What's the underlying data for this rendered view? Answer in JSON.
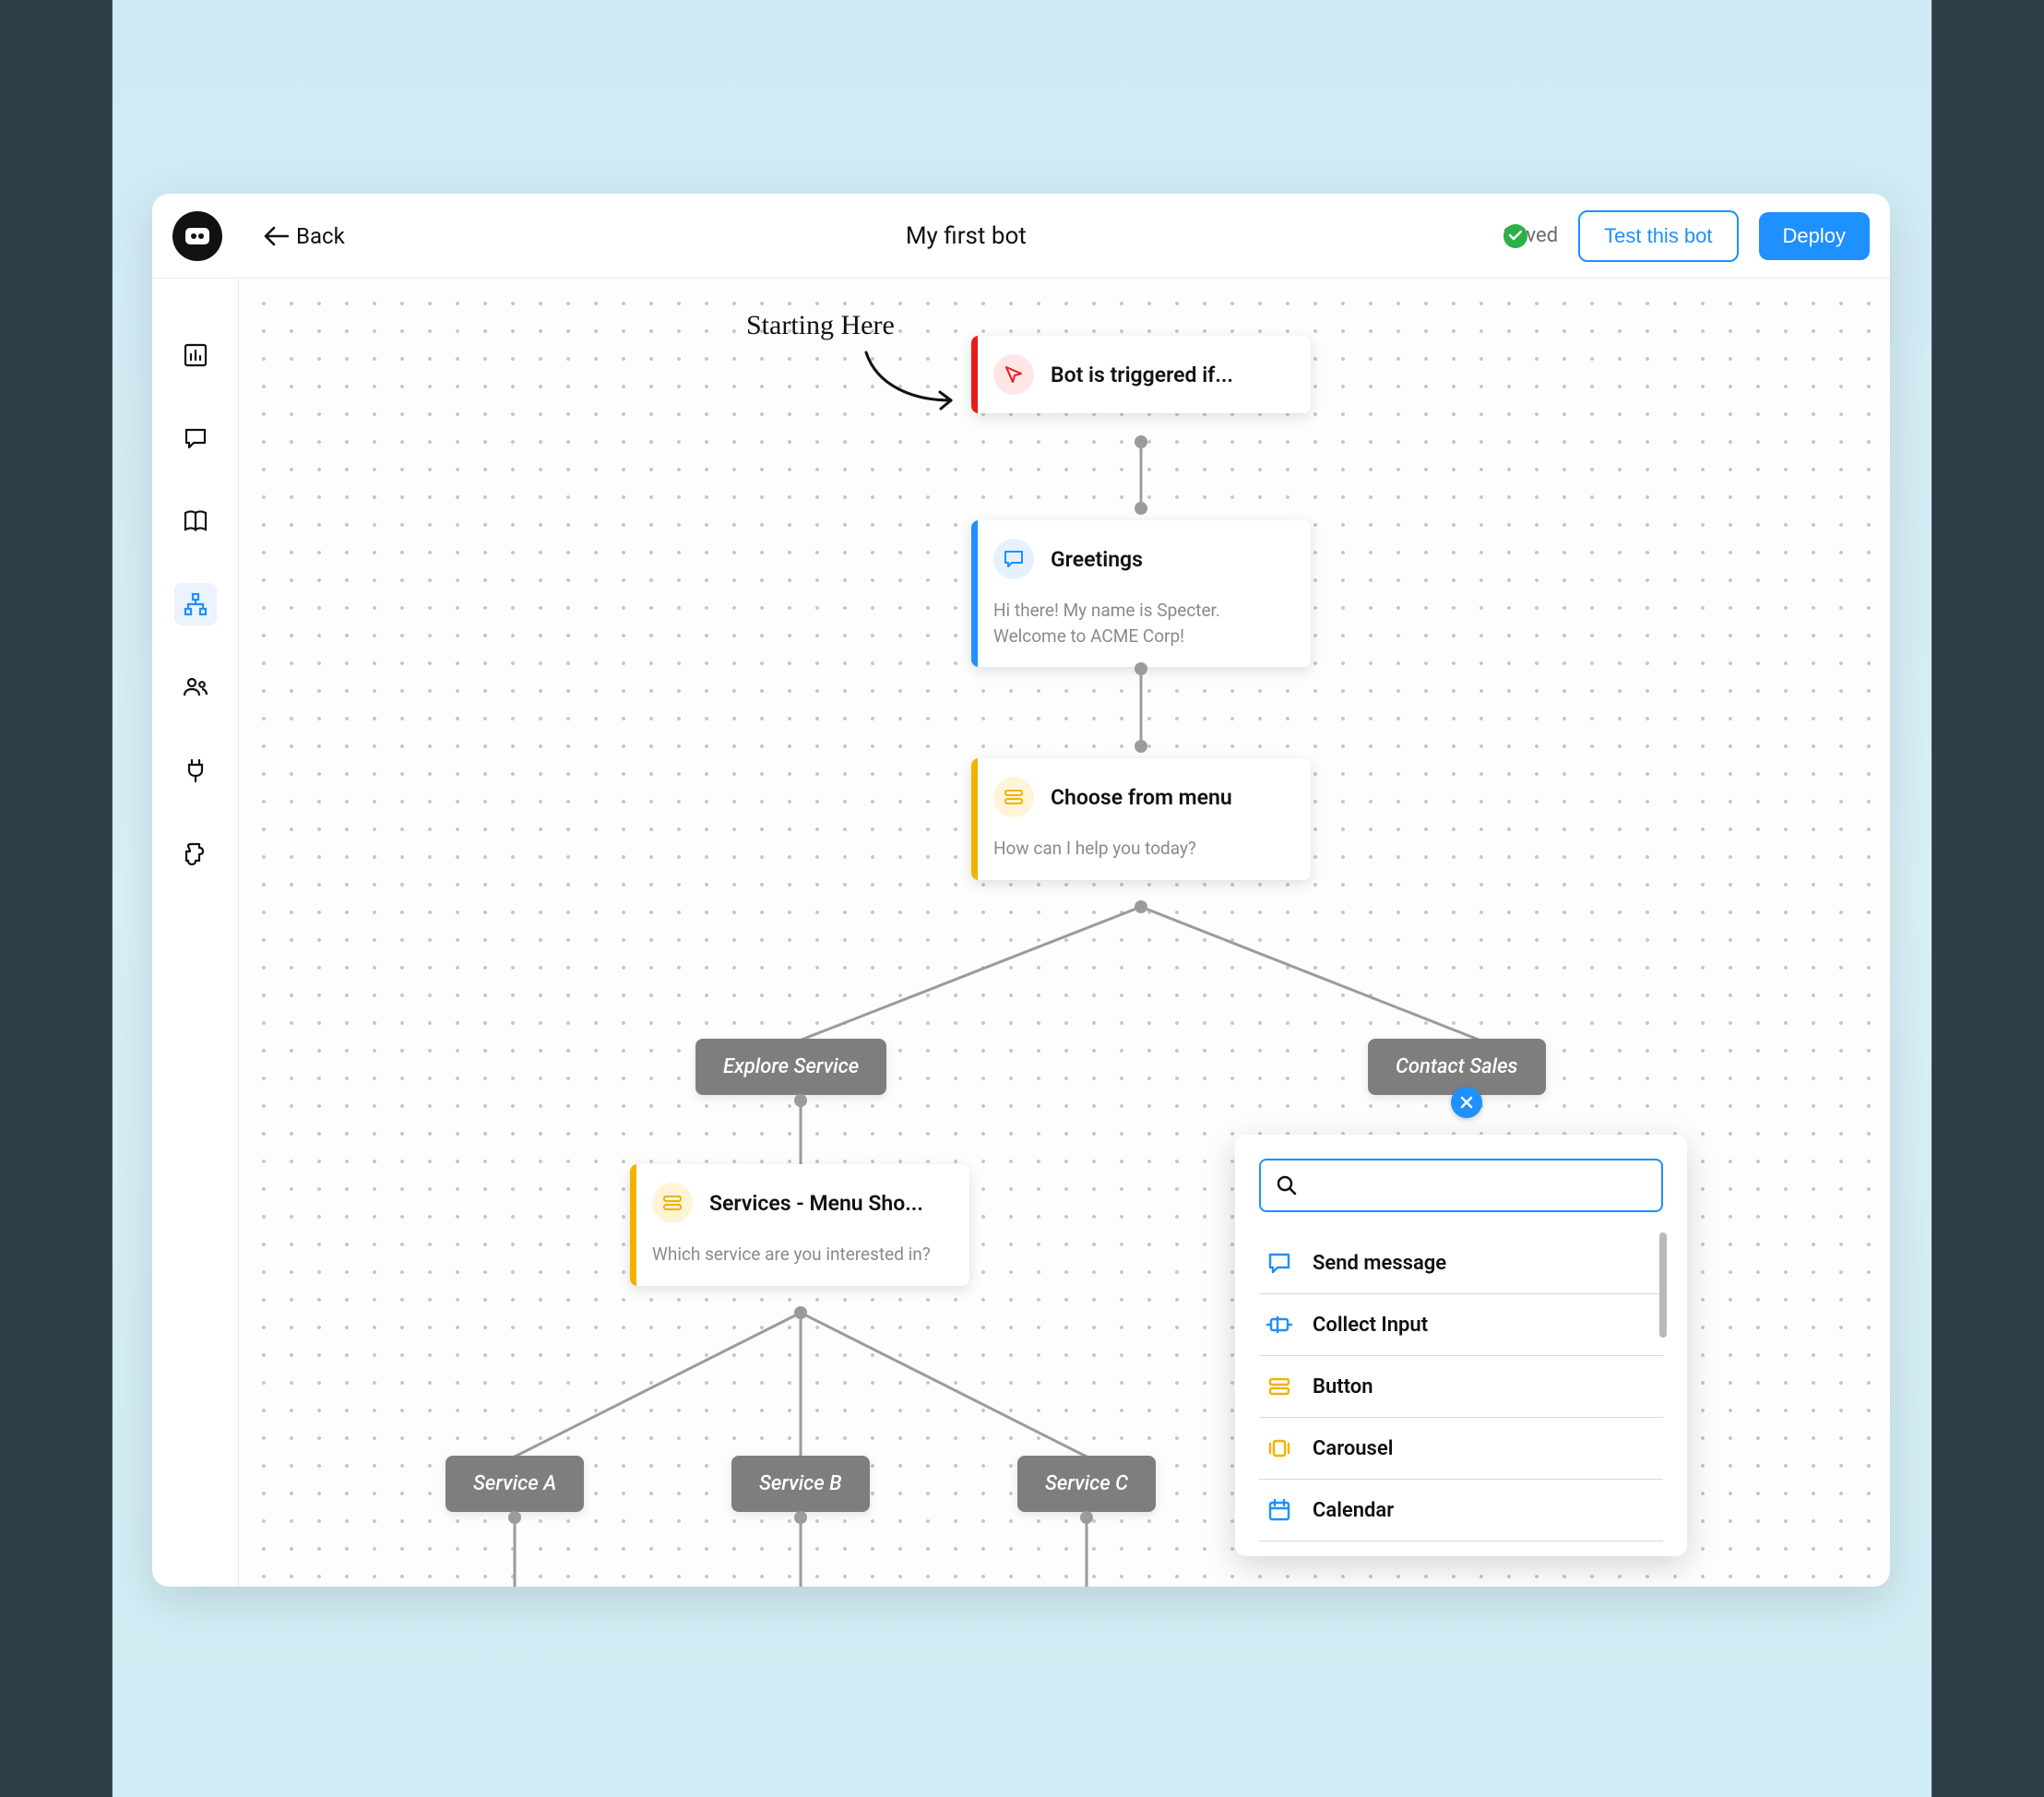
{
  "header": {
    "back_label": "Back",
    "title": "My first bot",
    "saved_label": "Saved",
    "test_label": "Test this bot",
    "deploy_label": "Deploy"
  },
  "annotation": {
    "starting_here": "Starting Here"
  },
  "nodes": {
    "trigger": {
      "title": "Bot is triggered if...",
      "accent": "#e81b1b"
    },
    "greetings": {
      "title": "Greetings",
      "body": "Hi there! My name is Specter. Welcome to ACME Corp!",
      "accent": "#1e90ff"
    },
    "menu": {
      "title": "Choose from menu",
      "body": "How can I help you today?",
      "accent": "#f2b200"
    },
    "services_menu": {
      "title": "Services - Menu Sho...",
      "body": "Which service are you interested in?",
      "accent": "#f2b200"
    }
  },
  "branches": {
    "explore": "Explore Service",
    "contact": "Contact Sales",
    "service_a": "Service A",
    "service_b": "Service B",
    "service_c": "Service C"
  },
  "popup": {
    "search_placeholder": "",
    "options": [
      {
        "label": "Send message",
        "icon": "message",
        "color": "#1e90ff"
      },
      {
        "label": "Collect Input",
        "icon": "collect",
        "color": "#1e90ff"
      },
      {
        "label": "Button",
        "icon": "button",
        "color": "#f2b200"
      },
      {
        "label": "Carousel",
        "icon": "carousel",
        "color": "#f2b200"
      },
      {
        "label": "Calendar",
        "icon": "calendar",
        "color": "#1e90ff"
      }
    ]
  }
}
